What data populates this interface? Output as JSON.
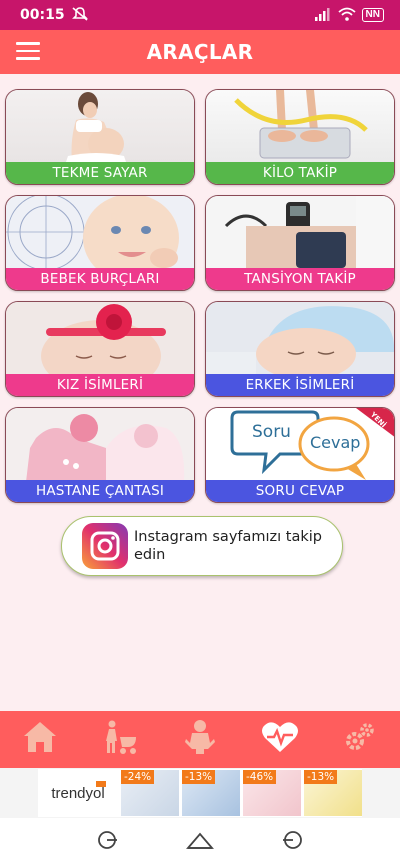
{
  "status_bar": {
    "time": "00:15",
    "battery": "NN"
  },
  "app_bar": {
    "title": "ARAÇLAR"
  },
  "tools": [
    {
      "label": "TEKME SAYAR",
      "color": "#56b74a"
    },
    {
      "label": "KİLO TAKİP",
      "color": "#56b74a"
    },
    {
      "label": "BEBEK BURÇLARI",
      "color": "#ee3a8c"
    },
    {
      "label": "TANSİYON TAKİP",
      "color": "#ee3a8c"
    },
    {
      "label": "KIZ İSİMLERİ",
      "color": "#ee3a8c"
    },
    {
      "label": "ERKEK İSİMLERİ",
      "color": "#4b55e0"
    },
    {
      "label": "HASTANE ÇANTASI",
      "color": "#4b55e0"
    },
    {
      "label": "SORU CEVAP",
      "color": "#4b55e0"
    }
  ],
  "soru_cevap_card": {
    "bubble_left": "Soru",
    "bubble_right": "Cevap",
    "ribbon": "YENİ"
  },
  "instagram_button": {
    "label": "Instagram sayfamızı takip edin"
  },
  "bottom_nav": [
    {
      "icon": "home-icon"
    },
    {
      "icon": "mother-stroller-icon"
    },
    {
      "icon": "baby-icon"
    },
    {
      "icon": "heart-pulse-icon"
    },
    {
      "icon": "gears-icon"
    }
  ],
  "ad": {
    "brand": "trendyol",
    "items": [
      {
        "discount": "-24%"
      },
      {
        "discount": "-13%"
      },
      {
        "discount": "-46%"
      },
      {
        "discount": "-13%"
      }
    ]
  },
  "system_nav": [
    {
      "icon": "recents-icon"
    },
    {
      "icon": "home-icon"
    },
    {
      "icon": "back-icon"
    }
  ]
}
